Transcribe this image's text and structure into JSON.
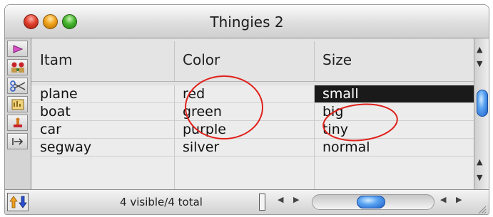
{
  "window": {
    "title": "Thingies 2"
  },
  "columns": [
    "Itam",
    "Color",
    "Size"
  ],
  "rows": [
    {
      "item": "plane",
      "color": "red",
      "size": "small"
    },
    {
      "item": "boat",
      "color": "green",
      "size": "big"
    },
    {
      "item": "car",
      "color": "purple",
      "size": "tiny"
    },
    {
      "item": "segway",
      "color": "silver",
      "size": "normal"
    }
  ],
  "selection": {
    "row": 1,
    "column": "Size"
  },
  "status": {
    "text": "4 visible/4 total"
  },
  "tools": [
    "pink-arrow-icon",
    "people-icon",
    "scissors-icon",
    "chart-icon",
    "stamp-icon",
    "right-arrow-icon"
  ],
  "highlight_color": "#e0201a",
  "selection_color": "#1a1a1a"
}
